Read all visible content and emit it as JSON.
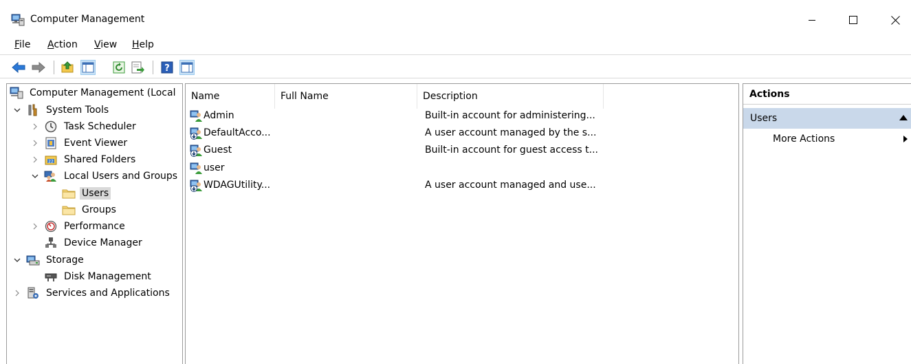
{
  "window": {
    "title": "Computer Management",
    "controls": [
      "minimize",
      "maximize",
      "close"
    ]
  },
  "menubar": {
    "items": [
      {
        "label": "File",
        "accel": "F",
        "rest": "ile"
      },
      {
        "label": "Action",
        "accel": "A",
        "rest": "ction"
      },
      {
        "label": "View",
        "accel": "V",
        "rest": "iew"
      },
      {
        "label": "Help",
        "accel": "H",
        "rest": "elp"
      }
    ]
  },
  "toolbar": {
    "buttons": [
      "back-icon",
      "forward-icon",
      "up-folder-icon",
      "show-hide-tree-icon",
      "refresh-icon",
      "export-list-icon",
      "help-icon",
      "show-hide-action-pane-icon"
    ]
  },
  "tree": {
    "items": [
      {
        "label": "Computer Management (Local",
        "icon": "computer-management-icon"
      },
      {
        "label": "System Tools",
        "icon": "system-tools-icon",
        "expanded": true
      },
      {
        "label": "Task Scheduler",
        "icon": "clock-icon",
        "expanded": false
      },
      {
        "label": "Event Viewer",
        "icon": "event-viewer-icon",
        "expanded": false
      },
      {
        "label": "Shared Folders",
        "icon": "shared-folders-icon",
        "expanded": false
      },
      {
        "label": "Local Users and Groups",
        "icon": "users-groups-icon",
        "expanded": true
      },
      {
        "label": "Users",
        "icon": "folder-icon",
        "selected": true
      },
      {
        "label": "Groups",
        "icon": "folder-icon"
      },
      {
        "label": "Performance",
        "icon": "performance-icon",
        "expanded": false
      },
      {
        "label": "Device Manager",
        "icon": "device-manager-icon"
      },
      {
        "label": "Storage",
        "icon": "storage-icon",
        "expanded": true
      },
      {
        "label": "Disk Management",
        "icon": "disk-icon"
      },
      {
        "label": "Services and Applications",
        "icon": "services-icon",
        "expanded": false
      }
    ]
  },
  "list": {
    "columns": [
      "Name",
      "Full Name",
      "Description"
    ],
    "rows": [
      {
        "name": "Admin",
        "full_name": "",
        "description": "Built-in account for administering...",
        "disabled": false
      },
      {
        "name": "DefaultAcco...",
        "full_name": "",
        "description": "A user account managed by the s...",
        "disabled": true
      },
      {
        "name": "Guest",
        "full_name": "",
        "description": "Built-in account for guest access t...",
        "disabled": true
      },
      {
        "name": "user",
        "full_name": "",
        "description": "",
        "disabled": false
      },
      {
        "name": "WDAGUtility...",
        "full_name": "",
        "description": "A user account managed and use...",
        "disabled": true
      }
    ]
  },
  "actions": {
    "title": "Actions",
    "section": "Users",
    "items": [
      "More Actions"
    ]
  },
  "colors": {
    "selection": "#d9d9d9",
    "action_section": "#c9d8ea",
    "border": "#9a9a9a"
  }
}
